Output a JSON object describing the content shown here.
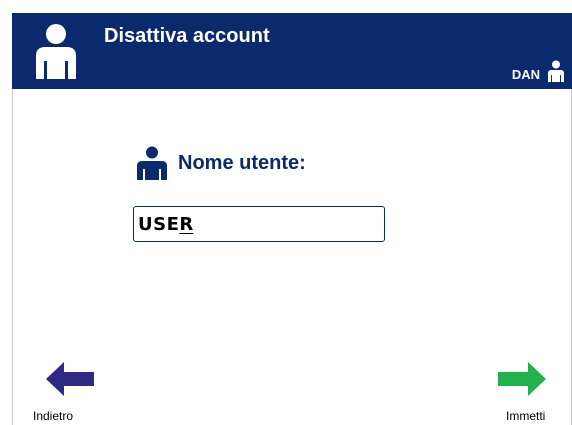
{
  "header": {
    "title": "Disattiva account",
    "user_code": "DAN",
    "icon": "user-icon",
    "background_color": "#0b2a6e"
  },
  "form": {
    "label": "Nome utente:",
    "label_icon": "user-icon",
    "input_value": "USE",
    "input_cursor_char": "R"
  },
  "navigation": {
    "back_label": "Indietro",
    "back_icon": "arrow-left-icon",
    "back_color": "#2e2a84",
    "enter_label": "Immetti",
    "enter_icon": "arrow-right-icon",
    "enter_color": "#22b14c"
  }
}
